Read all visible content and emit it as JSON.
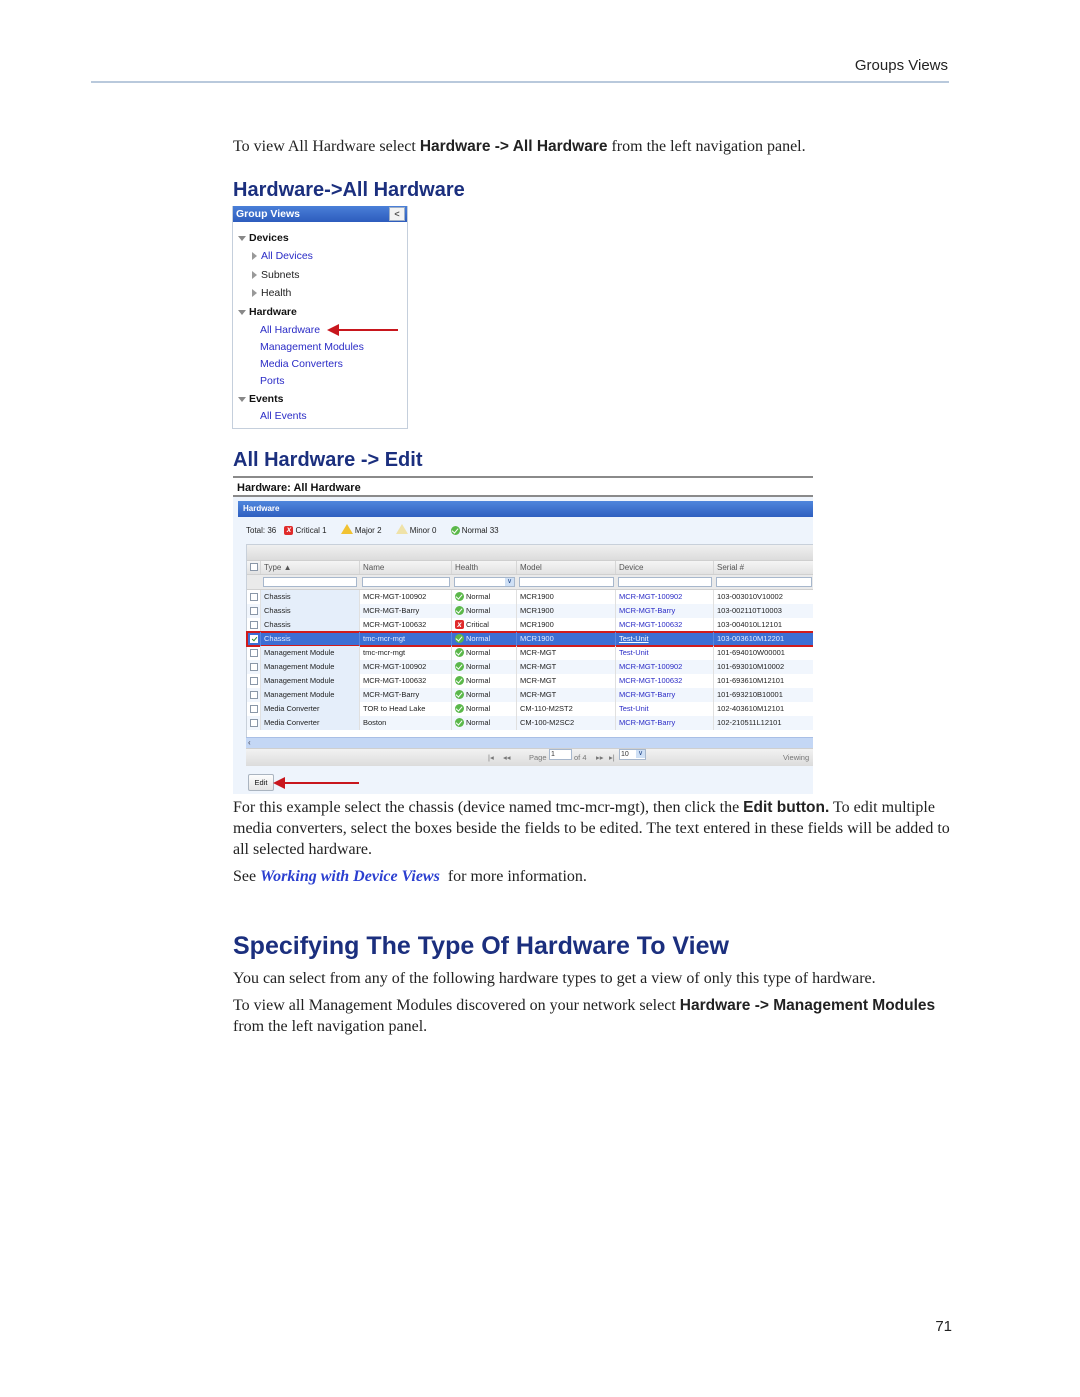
{
  "running_header": "Groups Views",
  "intro": {
    "pre": "To view All Hardware select ",
    "bold": "Hardware -> All Hardware",
    "post": " from the left navigation panel."
  },
  "section1_heading": "Hardware->All Hardware",
  "nav_panel": {
    "title": "Group Views",
    "collapse_glyph": "<",
    "items": [
      {
        "label": "Devices",
        "kind": "group"
      },
      {
        "label": "All Devices",
        "kind": "link-expandable"
      },
      {
        "label": "Subnets",
        "kind": "plain-expandable"
      },
      {
        "label": "Health",
        "kind": "plain-expandable"
      },
      {
        "label": "Hardware",
        "kind": "group"
      },
      {
        "label": "All Hardware",
        "kind": "link"
      },
      {
        "label": "Management Modules",
        "kind": "link"
      },
      {
        "label": "Media Converters",
        "kind": "link"
      },
      {
        "label": "Ports",
        "kind": "link"
      },
      {
        "label": "Events",
        "kind": "group"
      },
      {
        "label": "All Events",
        "kind": "link"
      }
    ]
  },
  "section2_heading": "All Hardware -> Edit",
  "hardware_panel": {
    "title": "Hardware: All Hardware",
    "bar_label": "Hardware",
    "summary": {
      "total": "Total: 36",
      "critical": "Critical 1",
      "major": "Major 2",
      "minor": "Minor 0",
      "normal": "Normal 33"
    },
    "columns": [
      "Type ▲",
      "Name",
      "Health",
      "Model",
      "Device",
      "Serial #"
    ],
    "rows": [
      {
        "type": "Chassis",
        "name": "MCR-MGT-100902",
        "health": "Normal",
        "model": "MCR1900",
        "device": "MCR-MGT-100902",
        "serial": "103-003010V10002",
        "checked": false
      },
      {
        "type": "Chassis",
        "name": "MCR-MGT-Barry",
        "health": "Normal",
        "model": "MCR1900",
        "device": "MCR-MGT-Barry",
        "serial": "103-002110T10003",
        "checked": false
      },
      {
        "type": "Chassis",
        "name": "MCR-MGT-100632",
        "health": "Critical",
        "model": "MCR1900",
        "device": "MCR-MGT-100632",
        "serial": "103-004010L12101",
        "checked": false
      },
      {
        "type": "Chassis",
        "name": "tmc-mcr-mgt",
        "health": "Normal",
        "model": "MCR1900",
        "device": "Test-Unit",
        "serial": "103-003610M12201",
        "checked": true
      },
      {
        "type": "Management Module",
        "name": "tmc-mcr-mgt",
        "health": "Normal",
        "model": "MCR-MGT",
        "device": "Test-Unit",
        "serial": "101-694010W00001",
        "checked": false
      },
      {
        "type": "Management Module",
        "name": "MCR-MGT-100902",
        "health": "Normal",
        "model": "MCR-MGT",
        "device": "MCR-MGT-100902",
        "serial": "101-693010M10002",
        "checked": false
      },
      {
        "type": "Management Module",
        "name": "MCR-MGT-100632",
        "health": "Normal",
        "model": "MCR-MGT",
        "device": "MCR-MGT-100632",
        "serial": "101-693610M12101",
        "checked": false
      },
      {
        "type": "Management Module",
        "name": "MCR-MGT-Barry",
        "health": "Normal",
        "model": "MCR-MGT",
        "device": "MCR-MGT-Barry",
        "serial": "101-693210B10001",
        "checked": false
      },
      {
        "type": "Media Converter",
        "name": "TOR to Head Lake",
        "health": "Normal",
        "model": "CM-110-M2ST2",
        "device": "Test-Unit",
        "serial": "102-403610M12101",
        "checked": false
      },
      {
        "type": "Media Converter",
        "name": "Boston",
        "health": "Normal",
        "model": "CM-100-M2SC2",
        "device": "MCR-MGT-Barry",
        "serial": "102-210511L12101",
        "checked": false
      }
    ],
    "pager": {
      "first": "|◂",
      "prev": "◂◂",
      "page_label": "Page",
      "page_value": "1",
      "of_label": "of 4",
      "next": "▸▸",
      "last": "▸|",
      "page_size": "10",
      "viewing": "Viewing"
    },
    "edit_button": "Edit"
  },
  "para_example": {
    "pre": "For this example select the chassis (device named tmc-mcr-mgt), then click the ",
    "bold": "Edit button.",
    "post": " To edit multiple media converters, select the boxes beside the fields to be edited. The text entered in these fields will be added to all selected hardware."
  },
  "see_also": {
    "pre": "See ",
    "link": "Working with Device Views",
    "post": "  for more information."
  },
  "section3_heading": "Specifying The Type Of Hardware To View",
  "para_types": "You can select from any of the following hardware types to get a view of only this type of hardware.",
  "para_mgmt": {
    "pre": "To view all Management Modules discovered on your network select ",
    "bold": "Hardware -> Management Modules",
    "post": " from the left navigation panel."
  },
  "page_number": "71",
  "colors": {
    "heading_blue": "#1b2f7e",
    "link_blue": "#2a2bc6",
    "annotation_red": "#c8161d",
    "selection_blue": "#3c6fd4",
    "panel_bar_blue": "#2f5fc0"
  }
}
